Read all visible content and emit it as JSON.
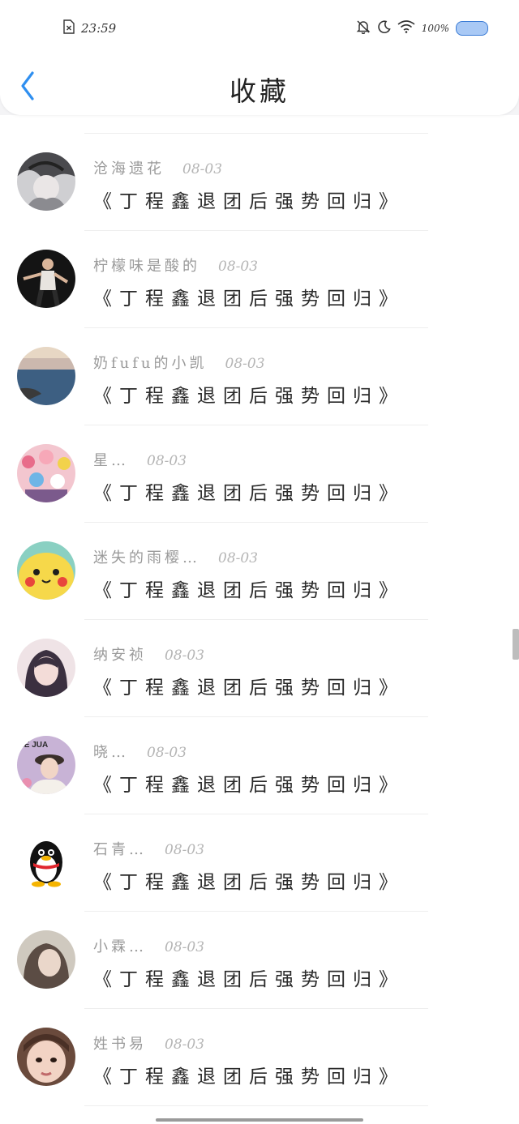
{
  "status_bar": {
    "time": "23:59",
    "battery": "100%",
    "battery_color": "#a9c9f5",
    "icons": [
      "sim-error-icon",
      "bell-off-icon",
      "moon-icon",
      "wifi-icon",
      "battery-icon"
    ]
  },
  "nav": {
    "title": "收藏",
    "back_icon": "back-chevron-icon",
    "accent": "#2f8ff0"
  },
  "items": [
    {
      "name": "沧海遗花",
      "date": "08-03",
      "title": "《丁程鑫退团后强势回归》",
      "avatar": "avatar-dark-illustration"
    },
    {
      "name": "柠檬味是酸的",
      "date": "08-03",
      "title": "《丁程鑫退团后强势回归》",
      "avatar": "avatar-dancer"
    },
    {
      "name": "奶fufu的小凯",
      "date": "08-03",
      "title": "《丁程鑫退团后强势回归》",
      "avatar": "avatar-seaside"
    },
    {
      "name": "星…",
      "date": "08-03",
      "title": "《丁程鑫退团后强势回归》",
      "avatar": "avatar-colorful-crowd"
    },
    {
      "name": "迷失的雨樱…",
      "date": "08-03",
      "title": "《丁程鑫退团后强势回归》",
      "avatar": "avatar-pikachu"
    },
    {
      "name": "纳安祯",
      "date": "08-03",
      "title": "《丁程鑫退团后强势回归》",
      "avatar": "avatar-anime-girl"
    },
    {
      "name": "晓…",
      "date": "08-03",
      "title": "《丁程鑫退团后强势回归》",
      "avatar": "avatar-girl-hat",
      "avatar_text": "IE JUA"
    },
    {
      "name": "石青…",
      "date": "08-03",
      "title": "《丁程鑫退团后强势回归》",
      "avatar": "avatar-penguin"
    },
    {
      "name": "小霖…",
      "date": "08-03",
      "title": "《丁程鑫退团后强势回归》",
      "avatar": "avatar-portrait-muted"
    },
    {
      "name": "姓书易",
      "date": "08-03",
      "title": "《丁程鑫退团后强势回归》",
      "avatar": "avatar-face-closeup"
    }
  ]
}
